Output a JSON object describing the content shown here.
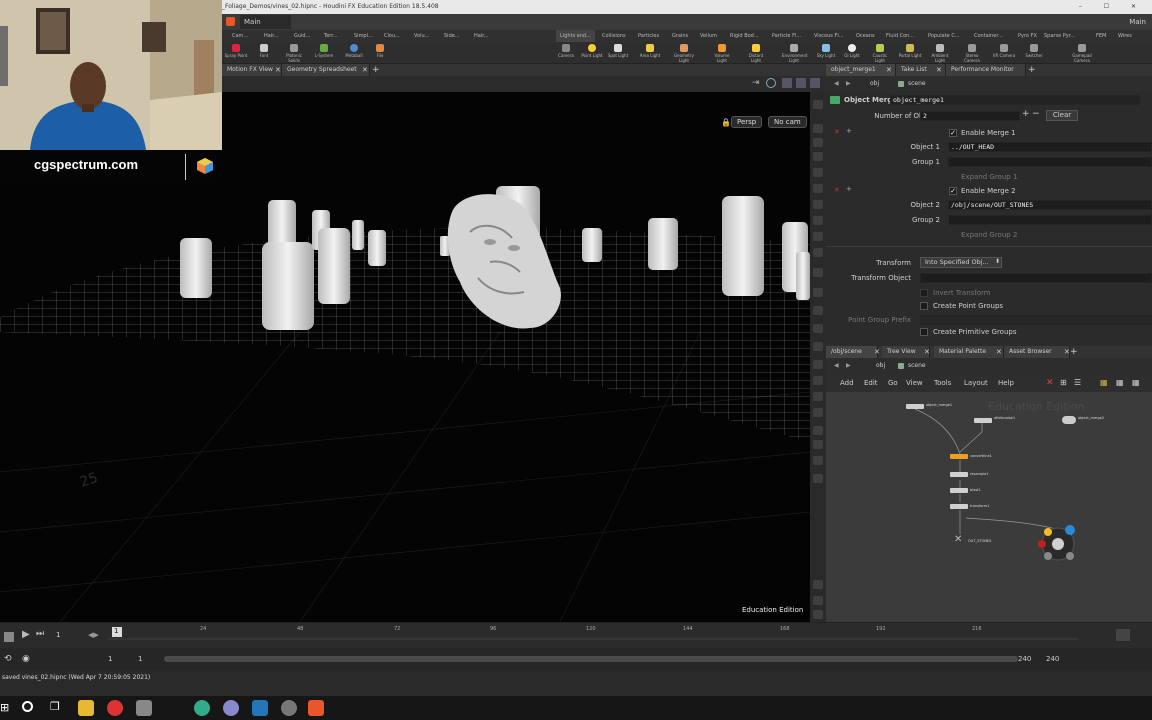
{
  "window": {
    "title": "_Foliage_Demos/vines_02.hipnc - Houdini FX Education Edition 18.5.408",
    "desktop_label": "Main",
    "controls": "– ☐ ✕"
  },
  "menubar": {
    "desktop": "Main",
    "desktop_right": "Main"
  },
  "shelf_tabs_left": [
    "Cam...",
    "Hair...",
    "Guid...",
    "Terr...",
    "Simpl...",
    "Clou...",
    "Volu...",
    "Side...",
    "Hair..."
  ],
  "shelf_tabs_right": [
    "Lights and...",
    "Collisions",
    "Particles",
    "Grains",
    "Vellum",
    "Rigid Bod...",
    "Particle Fl...",
    "Viscous Fl...",
    "Oceans",
    "Fluid Con...",
    "Populate C...",
    "Container...",
    "Pyro FX",
    "Sparse Pyr...",
    "FEM",
    "Wires"
  ],
  "shelf_tools_left": [
    "Spray Paint",
    "Font",
    "Platonic Solids",
    "L-System",
    "Metaball",
    "File"
  ],
  "shelf_tools_right": [
    "Camera",
    "Point Light",
    "Spot Light",
    "Area Light",
    "Geometry Light",
    "Volume Light",
    "Distant Light",
    "Environment Light",
    "Sky Light",
    "GI Light",
    "Caustic Light",
    "Portal Light",
    "Ambient Light",
    "Stereo Camera",
    "VR Camera",
    "Switcher",
    "Gamepad Camera"
  ],
  "viewport_tabs": [
    "Motion FX View",
    "Geometry Spreadsheet"
  ],
  "viewport": {
    "persp_button": "Persp",
    "cam_button": "No cam",
    "watermark": "Education Edition",
    "floor_label": "25"
  },
  "webcam": {
    "banner_text": "cgspectrum.com"
  },
  "param_tabs": [
    "object_merge1",
    "Take List",
    "Performance Monitor"
  ],
  "param_nav": {
    "path_obj": "obj",
    "path_scene": "scene"
  },
  "params": {
    "node_type": "Object Merge",
    "node_name": "object_merge1",
    "num_objects_label": "Number of Objects",
    "num_objects_value": "2",
    "clear_label": "Clear",
    "enable_merge1": "Enable Merge 1",
    "object1_label": "Object 1",
    "object1_value": "../OUT_HEAD",
    "group1_label": "Group 1",
    "expand_group1": "Expand Group 1",
    "enable_merge2": "Enable Merge 2",
    "object2_label": "Object 2",
    "object2_value": "/obj/scene/OUT_STONES",
    "group2_label": "Group 2",
    "expand_group2": "Expand Group 2",
    "transform_label": "Transform",
    "transform_value": "Into Specified Obj...",
    "transform_object_label": "Transform Object",
    "invert_transform": "Invert Transform",
    "create_point_groups": "Create Point Groups",
    "point_group_prefix_label": "Point Group Prefix",
    "create_primitive_groups": "Create Primitive Groups"
  },
  "net_tabs": [
    "/obj/scene",
    "Tree View",
    "Material Palette",
    "Asset Browser"
  ],
  "net_nav": {
    "path_obj": "obj",
    "path_scene": "scene"
  },
  "net_menu": [
    "Add",
    "Edit",
    "Go",
    "View",
    "Tools",
    "Layout",
    "Help"
  ],
  "network": {
    "watermark": "Education Edition",
    "nodes": [
      "object_merge1",
      "attribnoise1",
      "object_merge2",
      "convertline1",
      "resample1",
      "blast1",
      "transform1",
      "OUT_STONES"
    ]
  },
  "timeline": {
    "ticks": [
      "24",
      "48",
      "72",
      "96",
      "120",
      "144",
      "168",
      "192",
      "216"
    ],
    "current_frame": "1",
    "start_frame": "1",
    "start_frame2": "1",
    "end_frame": "240",
    "end_frame2": "240"
  },
  "status": {
    "text": "saved vines_02.hipnc (Wed Apr 7 20:59:05 2021)"
  },
  "colors": {
    "accent_orange": "#f0a020",
    "edu_red": "#c02020",
    "selection_blue": "#3a6ea5"
  }
}
